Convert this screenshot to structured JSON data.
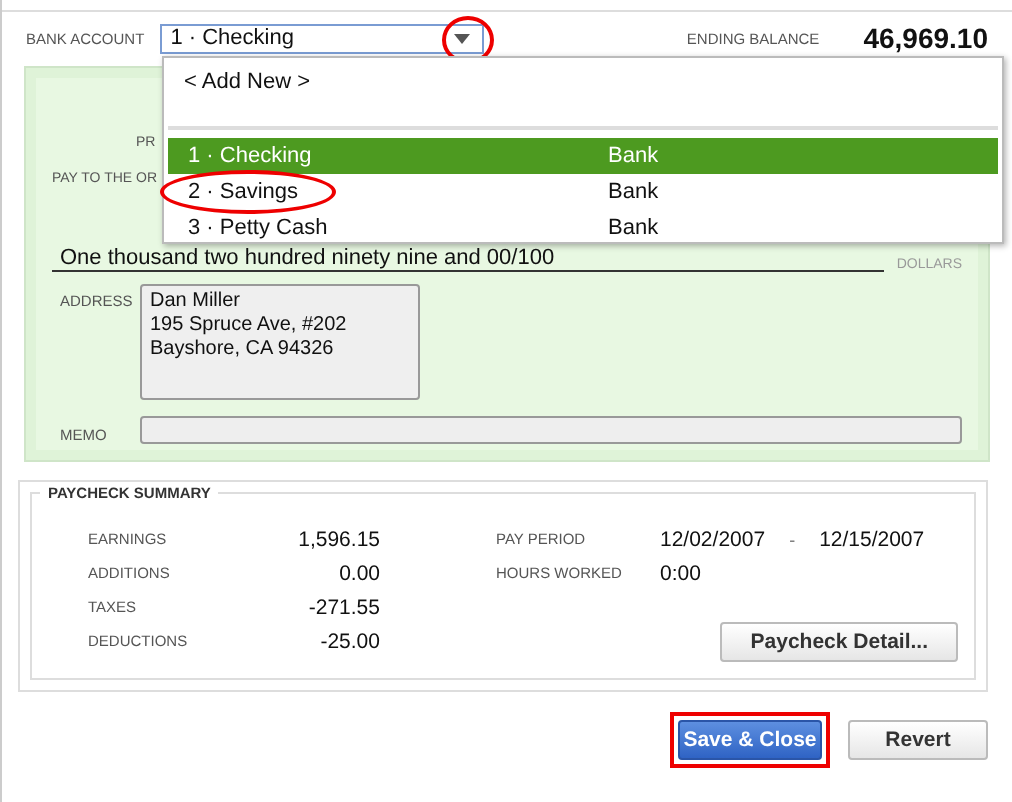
{
  "header": {
    "bank_account_label": "BANK ACCOUNT",
    "bank_account_value": "1 · Checking",
    "arrow_circled": true,
    "ending_balance_label": "ENDING BALANCE",
    "ending_balance": "46,969.10"
  },
  "dropdown": {
    "add_new": "< Add New >",
    "items": [
      {
        "name": "1 · Checking",
        "type": "Bank",
        "selected": true,
        "circled": false
      },
      {
        "name": "2 · Savings",
        "type": "Bank",
        "selected": false,
        "circled": true
      },
      {
        "name": "3 · Petty Cash",
        "type": "Bank",
        "selected": false,
        "circled": false
      }
    ]
  },
  "check": {
    "print_label": "PR",
    "pay_to_label": "PAY TO THE OR",
    "amount_words": "One thousand two hundred ninety nine and 00/100",
    "dollars_label": "DOLLARS",
    "address_label": "ADDRESS",
    "address_lines": [
      "Dan Miller",
      "195 Spruce Ave, #202",
      "Bayshore, CA 94326"
    ],
    "memo_label": "MEMO"
  },
  "summary": {
    "title": "PAYCHECK SUMMARY",
    "rows": [
      {
        "label": "EARNINGS",
        "value": "1,596.15"
      },
      {
        "label": "ADDITIONS",
        "value": "0.00"
      },
      {
        "label": "TAXES",
        "value": "-271.55"
      },
      {
        "label": "DEDUCTIONS",
        "value": "-25.00"
      }
    ],
    "pay_period_label": "PAY PERIOD",
    "pay_period_from": "12/02/2007",
    "pay_period_sep": "-",
    "pay_period_to": "12/15/2007",
    "hours_label": "HOURS WORKED",
    "hours": "0:00",
    "detail_button": "Paycheck Detail..."
  },
  "buttons": [
    {
      "label": "Save & Close",
      "kind": "primary",
      "outlined": true
    },
    {
      "label": "Revert",
      "kind": "secondary",
      "outlined": false
    }
  ]
}
